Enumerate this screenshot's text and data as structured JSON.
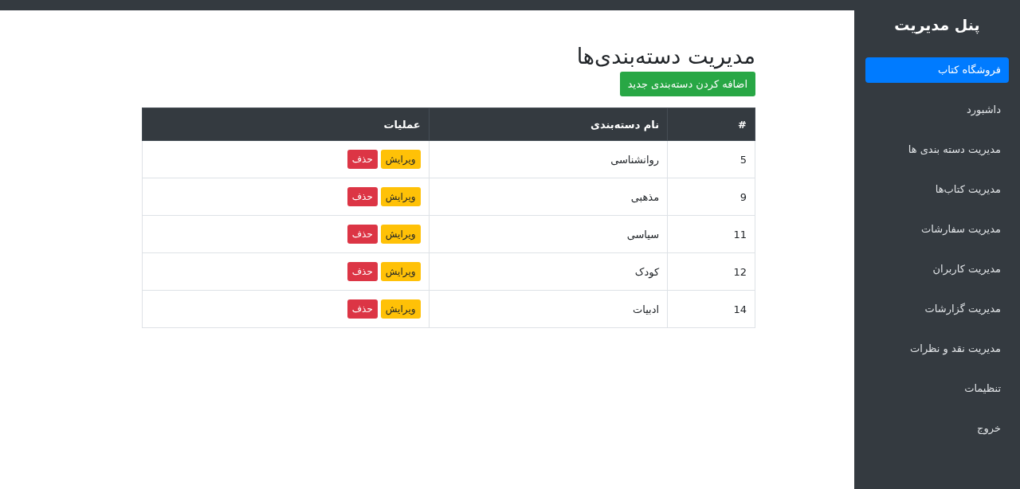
{
  "sidebar": {
    "title": "پنل مدیریت",
    "items": [
      {
        "label": "فروشگاه کتاب",
        "selected": true
      },
      {
        "label": "داشبورد",
        "selected": false
      },
      {
        "label": "مدیریت دسته بندی ها",
        "selected": false
      },
      {
        "label": "مدیریت کتاب‌ها",
        "selected": false
      },
      {
        "label": "مدیریت سفارشات",
        "selected": false
      },
      {
        "label": "مدیریت کاربران",
        "selected": false
      },
      {
        "label": "مدیریت گزارشات",
        "selected": false
      },
      {
        "label": "مدیریت نقد و نظرات",
        "selected": false
      },
      {
        "label": "تنظیمات",
        "selected": false
      },
      {
        "label": "خروج",
        "selected": false
      }
    ]
  },
  "page": {
    "title": "مدیریت دسته‌بندی‌ها",
    "add_button": "اضافه کردن دسته‌بندی جدید"
  },
  "table": {
    "columns": [
      "#",
      "نام دسته‌بندی",
      "عملیات"
    ],
    "rows": [
      {
        "id": "5",
        "name": "روانشناسی",
        "actions": [
          "ویرایش",
          "حذف"
        ]
      },
      {
        "id": "9",
        "name": "مذهبی",
        "actions": [
          "ویرایش",
          "حذف"
        ]
      },
      {
        "id": "11",
        "name": "سیاسی",
        "actions": [
          "ویرایش",
          "حذف"
        ]
      },
      {
        "id": "12",
        "name": "کودک",
        "actions": [
          "ویرایش",
          "حذف"
        ]
      },
      {
        "id": "14",
        "name": "ادبیات",
        "actions": [
          "ویرایش",
          "حذف"
        ]
      }
    ]
  }
}
